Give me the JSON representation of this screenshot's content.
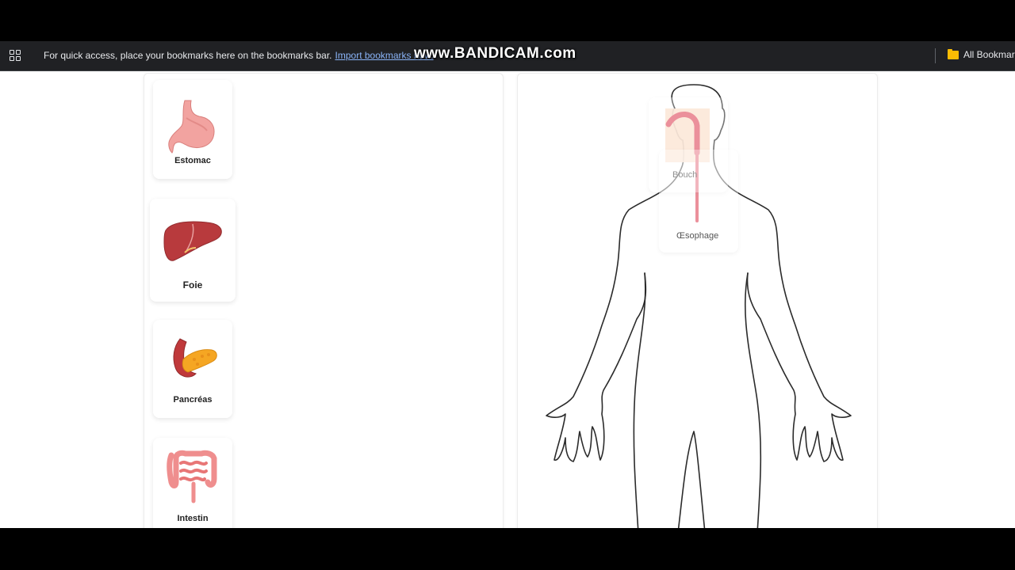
{
  "bookmarks_bar": {
    "message": "For quick access, place your bookmarks here on the bookmarks bar.",
    "import_link": "Import bookmarks now.",
    "all_bookmarks": "All Bookmark"
  },
  "watermark": "www.BANDICAM.com",
  "organ_cards": [
    {
      "label": "Estomac",
      "icon": "stomach-icon"
    },
    {
      "label": "Foie",
      "icon": "liver-icon"
    },
    {
      "label": "Pancréas",
      "icon": "pancreas-icon"
    },
    {
      "label": "Intestin",
      "icon": "intestine-icon"
    }
  ],
  "body_diagram": {
    "placed_items": [
      {
        "label": "Bouch",
        "icon": "mouth-icon"
      },
      {
        "label": "Œsophage",
        "icon": "esophagus-icon"
      }
    ]
  },
  "colors": {
    "bookmark_bar_bg": "#202124",
    "link": "#8ab4f8",
    "organ_pink": "#ef8e8e",
    "organ_red": "#c0393b"
  }
}
